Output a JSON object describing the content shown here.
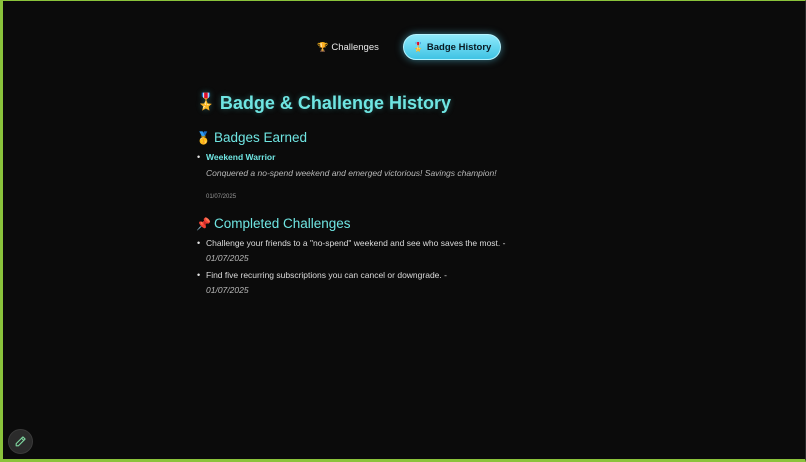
{
  "tabs": [
    {
      "icon": "🏆",
      "label": "Challenges",
      "active": false
    },
    {
      "icon": "🎖️",
      "label": "Badge History",
      "active": true
    }
  ],
  "page": {
    "icon": "🎖️",
    "title": "Badge & Challenge History"
  },
  "badges_section": {
    "icon": "🥇",
    "title": "Badges Earned",
    "items": [
      {
        "name": "Weekend Warrior",
        "description": "Conquered a no-spend weekend and emerged victorious! Savings champion!",
        "date": "01/07/2025"
      }
    ]
  },
  "challenges_section": {
    "icon": "📌",
    "title": "Completed Challenges",
    "items": [
      {
        "text": "Challenge your friends to a \"no-spend\" weekend and see who saves the most. -",
        "date": "01/07/2025"
      },
      {
        "text": "Find five recurring subscriptions you can cancel or downgrade. -",
        "date": "01/07/2025"
      }
    ]
  },
  "colors": {
    "accent": "#6fe5e2",
    "active_tab": "#3fc3e4",
    "frame": "#8ac33b",
    "background": "#0b0b0b"
  },
  "edit_button": {
    "icon": "pencil-icon"
  }
}
